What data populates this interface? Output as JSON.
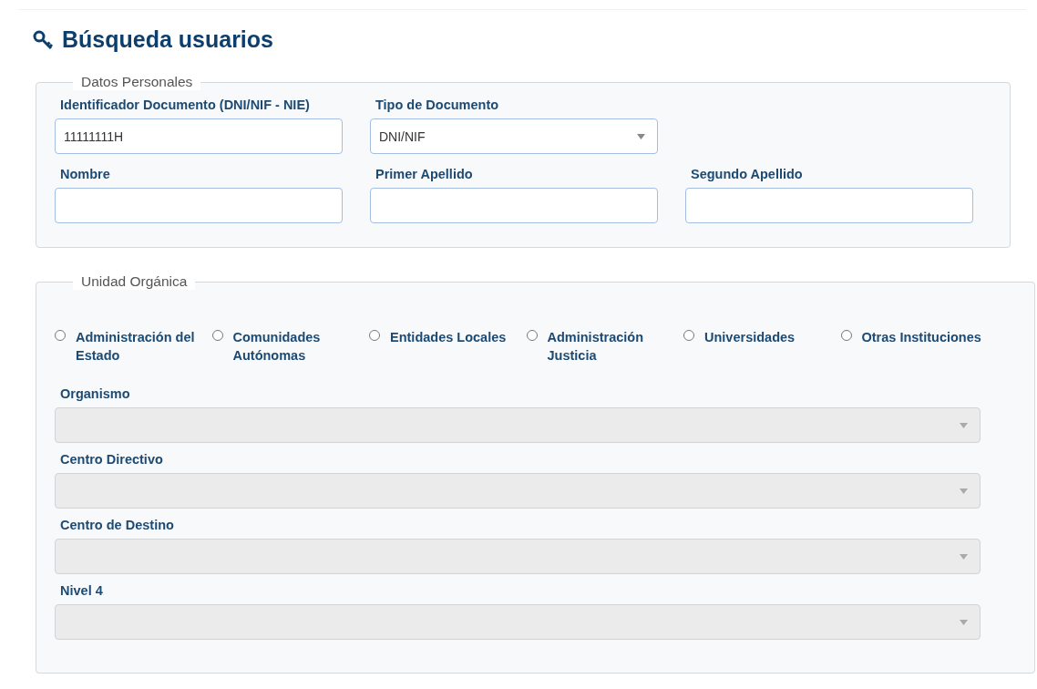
{
  "title": "Búsqueda usuarios",
  "personal": {
    "legend": "Datos Personales",
    "rows": [
      [
        {
          "kind": "input",
          "label": "Identificador Documento (DNI/NIF - NIE)",
          "value": "11111111H",
          "disabled": false
        },
        {
          "kind": "select",
          "label": "Tipo de Documento",
          "value": "DNI/NIF",
          "disabled": false
        }
      ],
      [
        {
          "kind": "input",
          "label": "Nombre",
          "disabled": false
        },
        {
          "kind": "input",
          "label": "Primer Apellido",
          "disabled": false
        },
        {
          "kind": "input",
          "label": "Segundo Apellido",
          "disabled": false
        }
      ]
    ]
  },
  "organic": {
    "legend": "Unidad Orgánica",
    "options": [
      {
        "label": "Administración del Estado",
        "selected": false
      },
      {
        "label": "Comunidades Autónomas",
        "selected": false
      },
      {
        "label": "Entidades Locales",
        "selected": false
      },
      {
        "label": "Administración Justicia",
        "selected": false
      },
      {
        "label": "Universidades",
        "selected": false
      },
      {
        "label": "Otras Instituciones",
        "selected": false
      }
    ],
    "selects": [
      {
        "label": "Organismo",
        "disabled": true
      },
      {
        "label": "Centro Directivo",
        "disabled": true
      },
      {
        "label": "Centro de Destino",
        "disabled": true
      },
      {
        "label": "Nivel 4",
        "disabled": true
      }
    ]
  }
}
